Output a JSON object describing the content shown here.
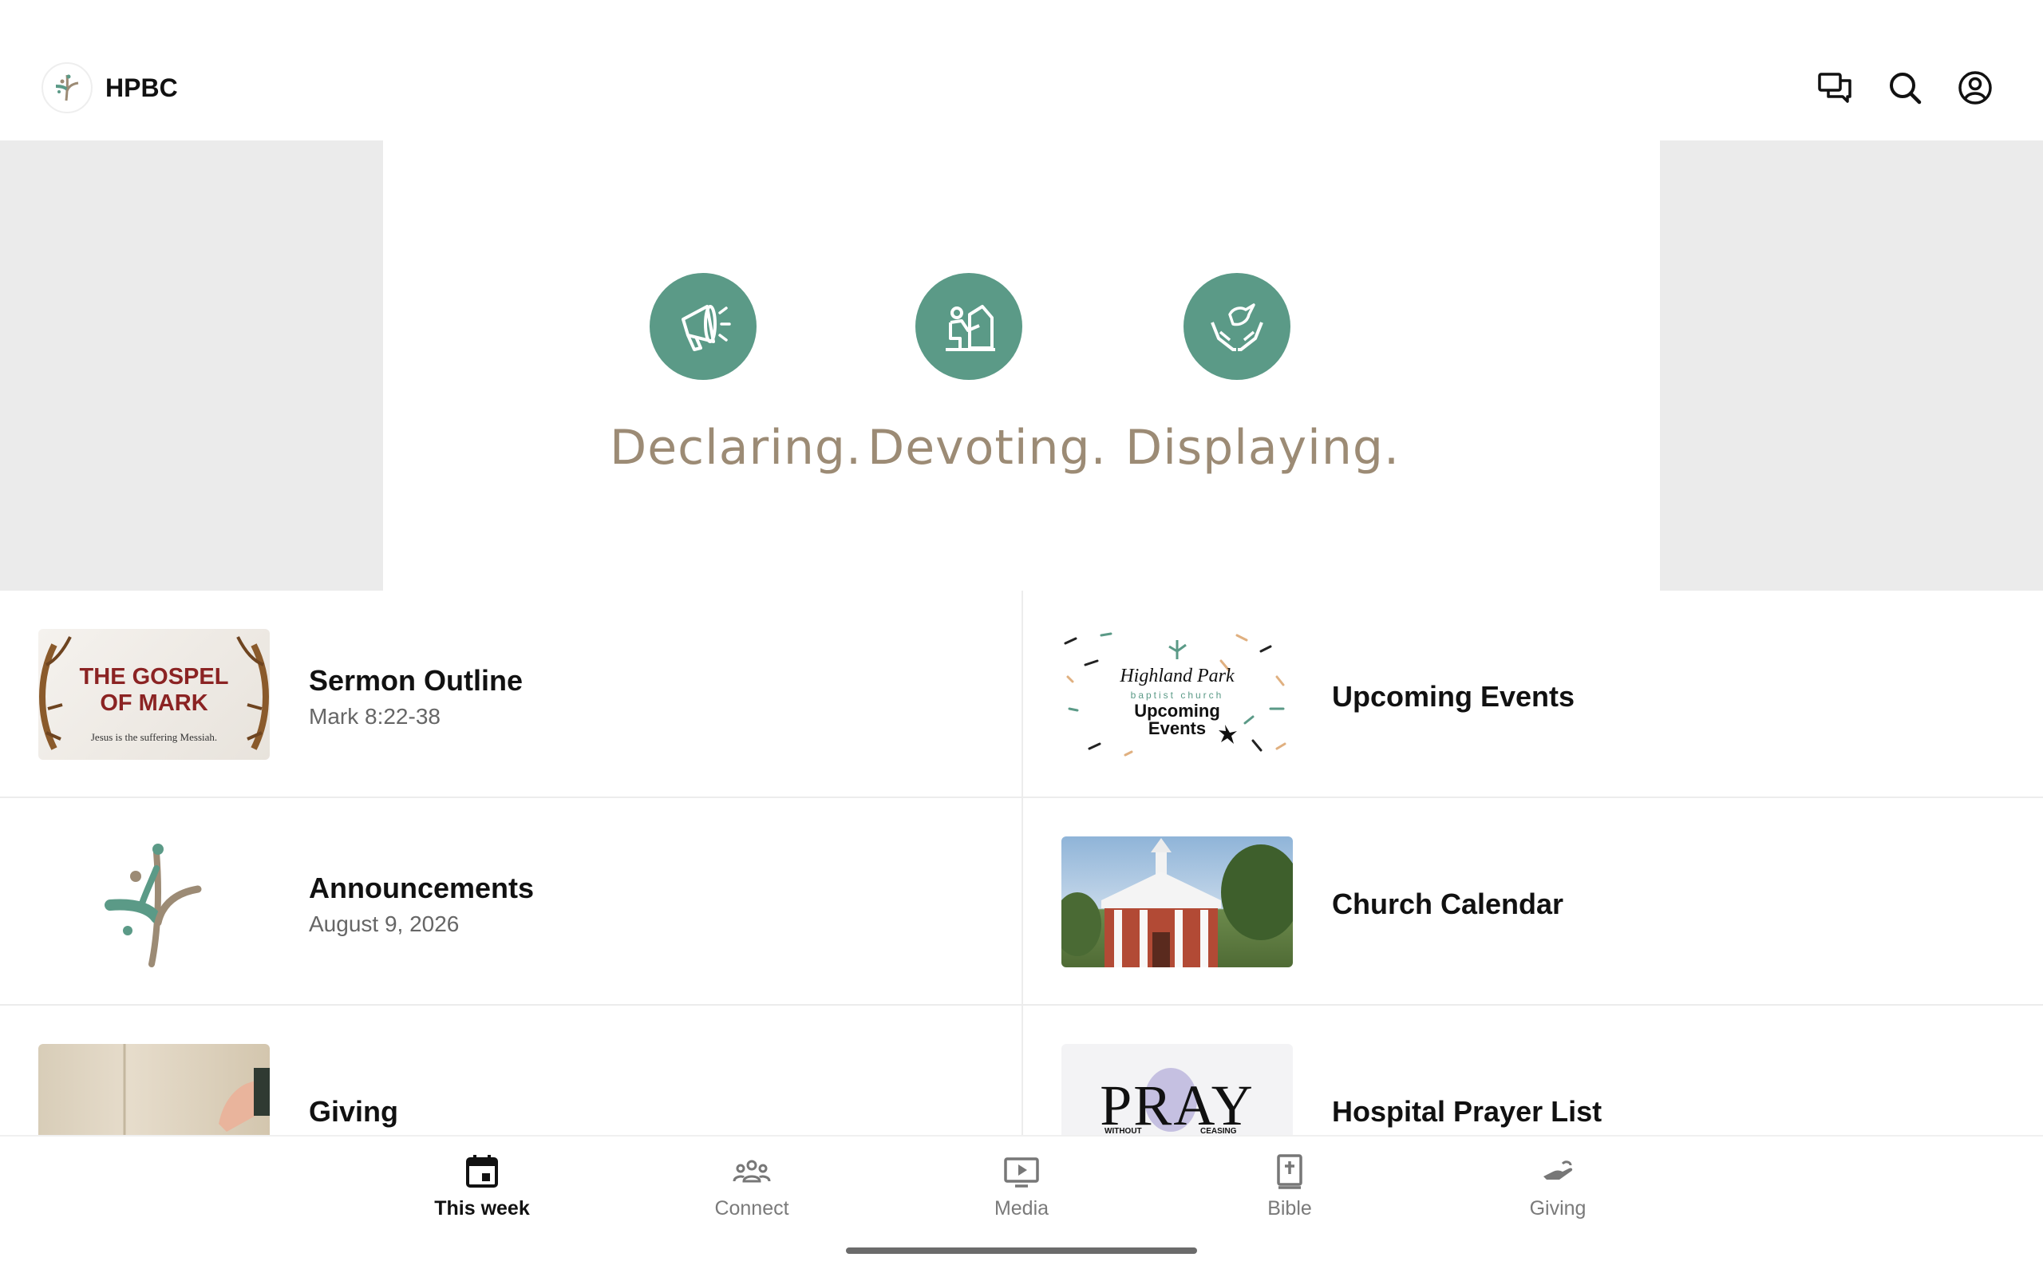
{
  "header": {
    "app_title": "HPBC",
    "icons": [
      "chat-icon",
      "search-icon",
      "account-icon"
    ]
  },
  "banner": {
    "pillars": [
      {
        "word": "Declaring.",
        "icon": "megaphone-icon"
      },
      {
        "word": "Devoting.",
        "icon": "kneeling-prayer-icon"
      },
      {
        "word": "Displaying.",
        "icon": "dove-hands-icon"
      }
    ]
  },
  "cards": [
    {
      "title": "Sermon Outline",
      "subtitle": "Mark 8:22-38",
      "thumb": {
        "line1": "THE GOSPEL",
        "line2": "OF MARK",
        "caption": "Jesus is the suffering Messiah."
      }
    },
    {
      "title": "Upcoming Events",
      "subtitle": "",
      "thumb": {
        "line1": "Highland Park",
        "line2": "baptist church",
        "line3": "Upcoming",
        "line4": "Events"
      }
    },
    {
      "title": "Announcements",
      "subtitle": "August 9, 2026"
    },
    {
      "title": "Church Calendar",
      "subtitle": ""
    },
    {
      "title": "Giving",
      "subtitle": ""
    },
    {
      "title": "Hospital Prayer List",
      "subtitle": "",
      "thumb": {
        "line1": "PRAY",
        "left": "WITHOUT",
        "right": "CEASING"
      }
    }
  ],
  "nav": {
    "items": [
      {
        "label": "This week",
        "icon": "calendar-icon",
        "active": true
      },
      {
        "label": "Connect",
        "icon": "people-icon",
        "active": false
      },
      {
        "label": "Media",
        "icon": "play-screen-icon",
        "active": false
      },
      {
        "label": "Bible",
        "icon": "bible-icon",
        "active": false
      },
      {
        "label": "Giving",
        "icon": "giving-hand-icon",
        "active": false
      }
    ]
  },
  "colors": {
    "accent_teal": "#5b9a87",
    "banner_text": "#9c8b75",
    "banner_side": "#ebebeb"
  }
}
